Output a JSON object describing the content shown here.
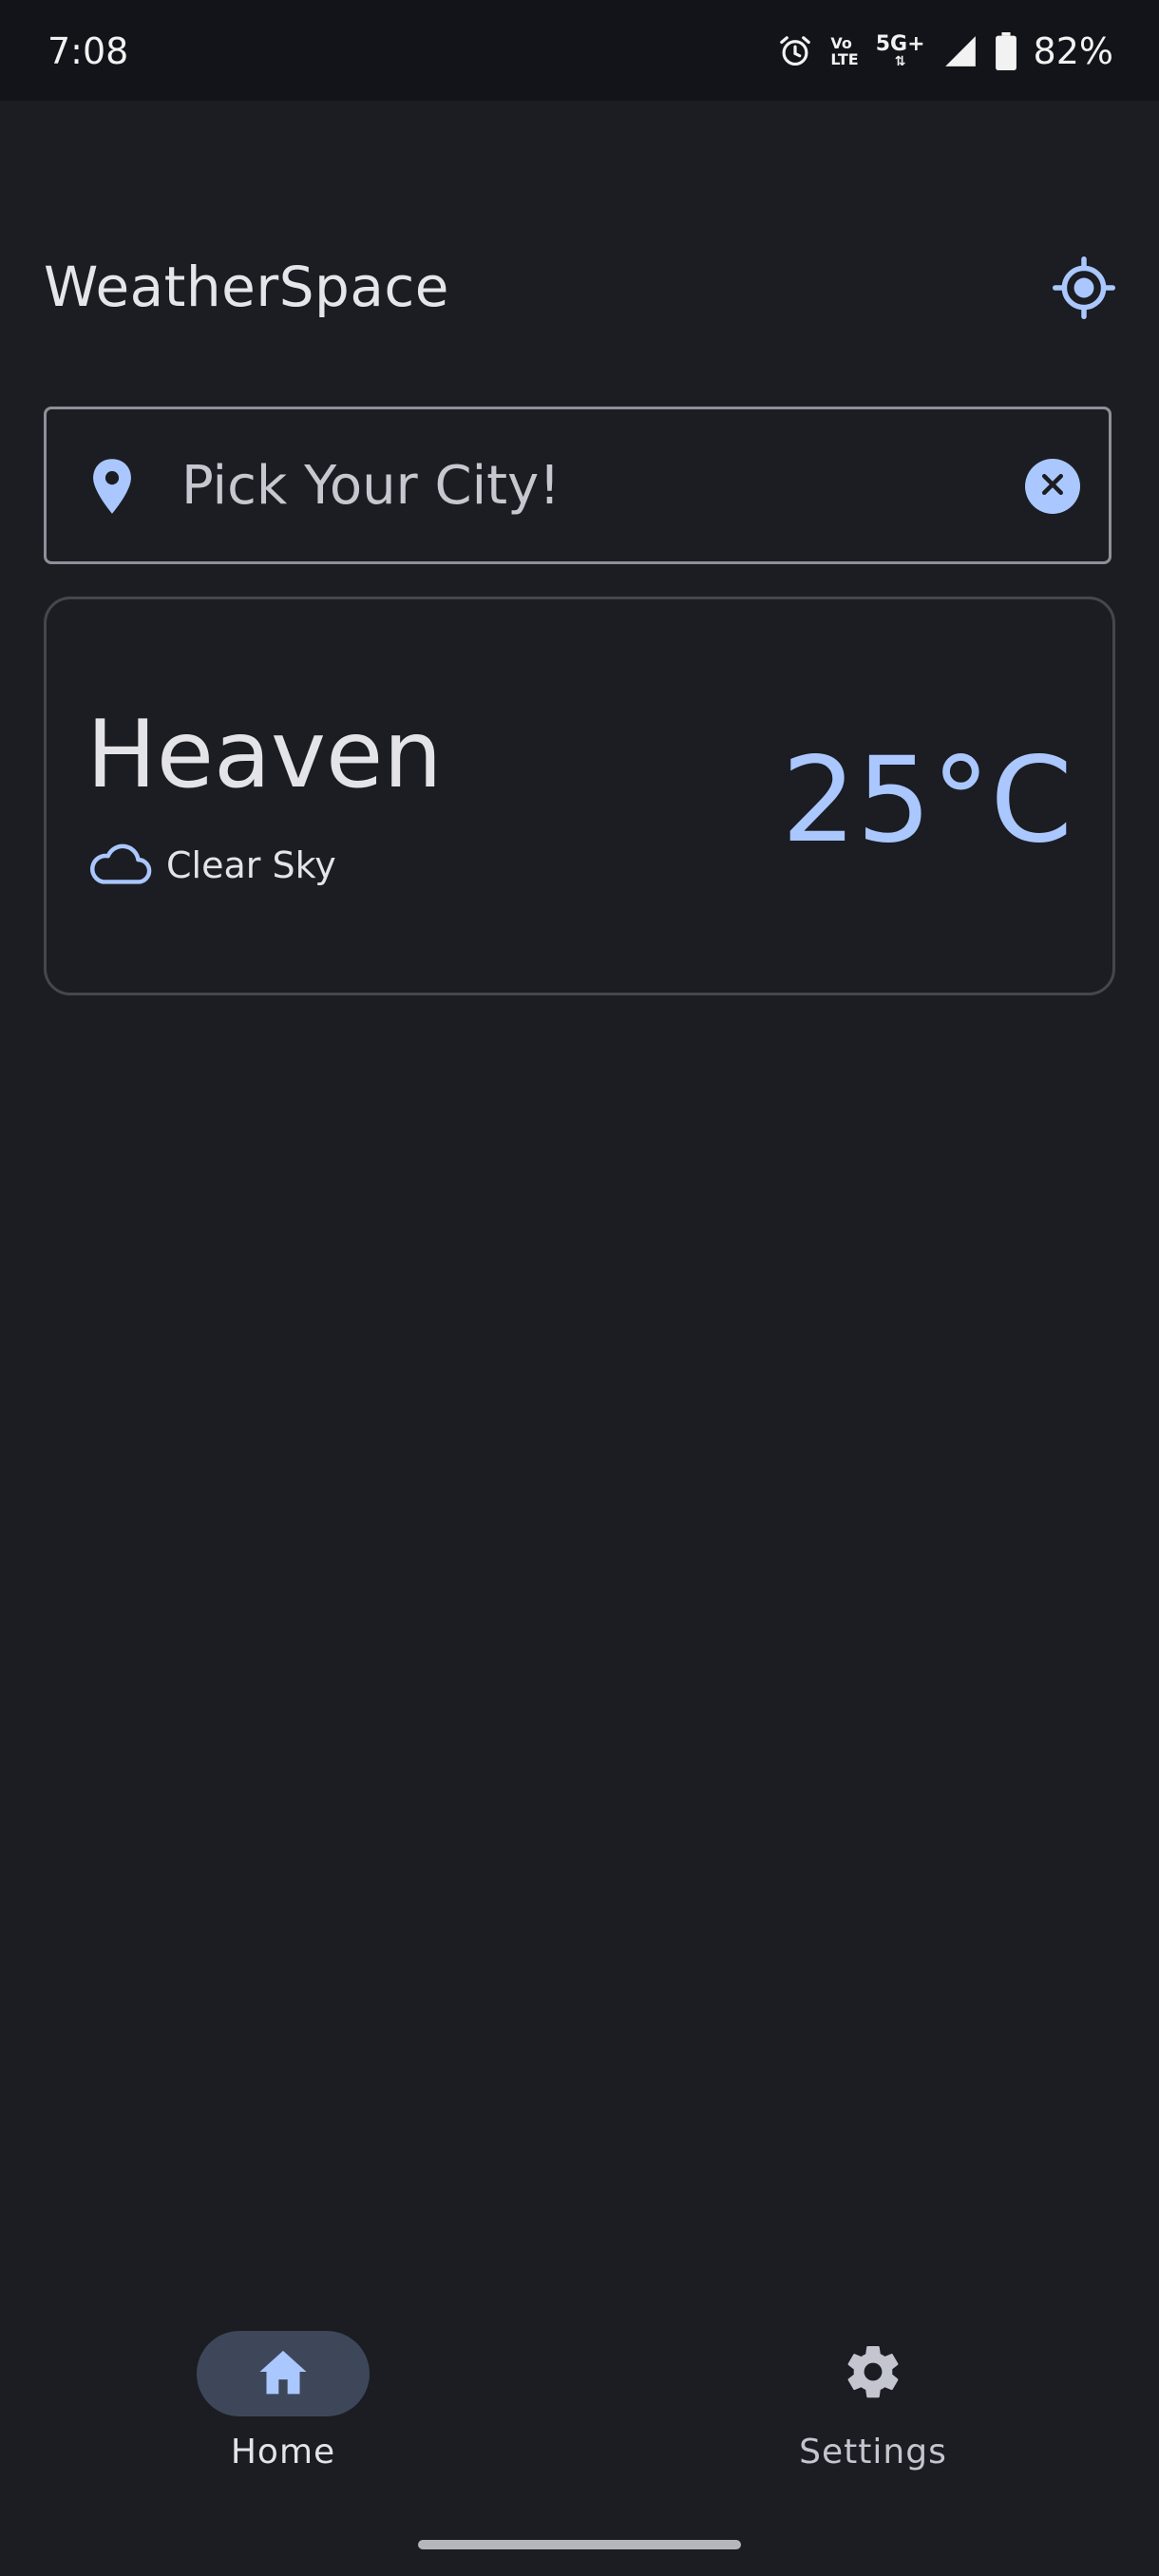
{
  "status_bar": {
    "time": "7:08",
    "battery": "82%",
    "volte_top": "Vo",
    "volte_bottom": "LTE",
    "network": "5G+",
    "icons": [
      "alarm-icon",
      "volte-icon",
      "5g-icon",
      "signal-icon",
      "battery-icon"
    ]
  },
  "header": {
    "title": "WeatherSpace",
    "action_icon": "my-location-icon"
  },
  "search": {
    "placeholder": "Pick Your City!",
    "value": "",
    "leading_icon": "location-pin-icon",
    "trailing_icon": "clear-icon"
  },
  "weather": {
    "city": "Heaven",
    "condition": "Clear Sky",
    "condition_icon": "cloud-icon",
    "temperature": "25°C"
  },
  "nav": {
    "items": [
      {
        "label": "Home",
        "icon": "home-icon",
        "selected": true
      },
      {
        "label": "Settings",
        "icon": "gear-icon",
        "selected": false
      }
    ]
  },
  "colors": {
    "background": "#1b1d22",
    "status_bar": "#121419",
    "accent": "#aac7ff",
    "selected_indicator": "#3e4759",
    "outline": "#8e9099",
    "card_outline": "#44474e",
    "text": "#e3e3e8"
  }
}
